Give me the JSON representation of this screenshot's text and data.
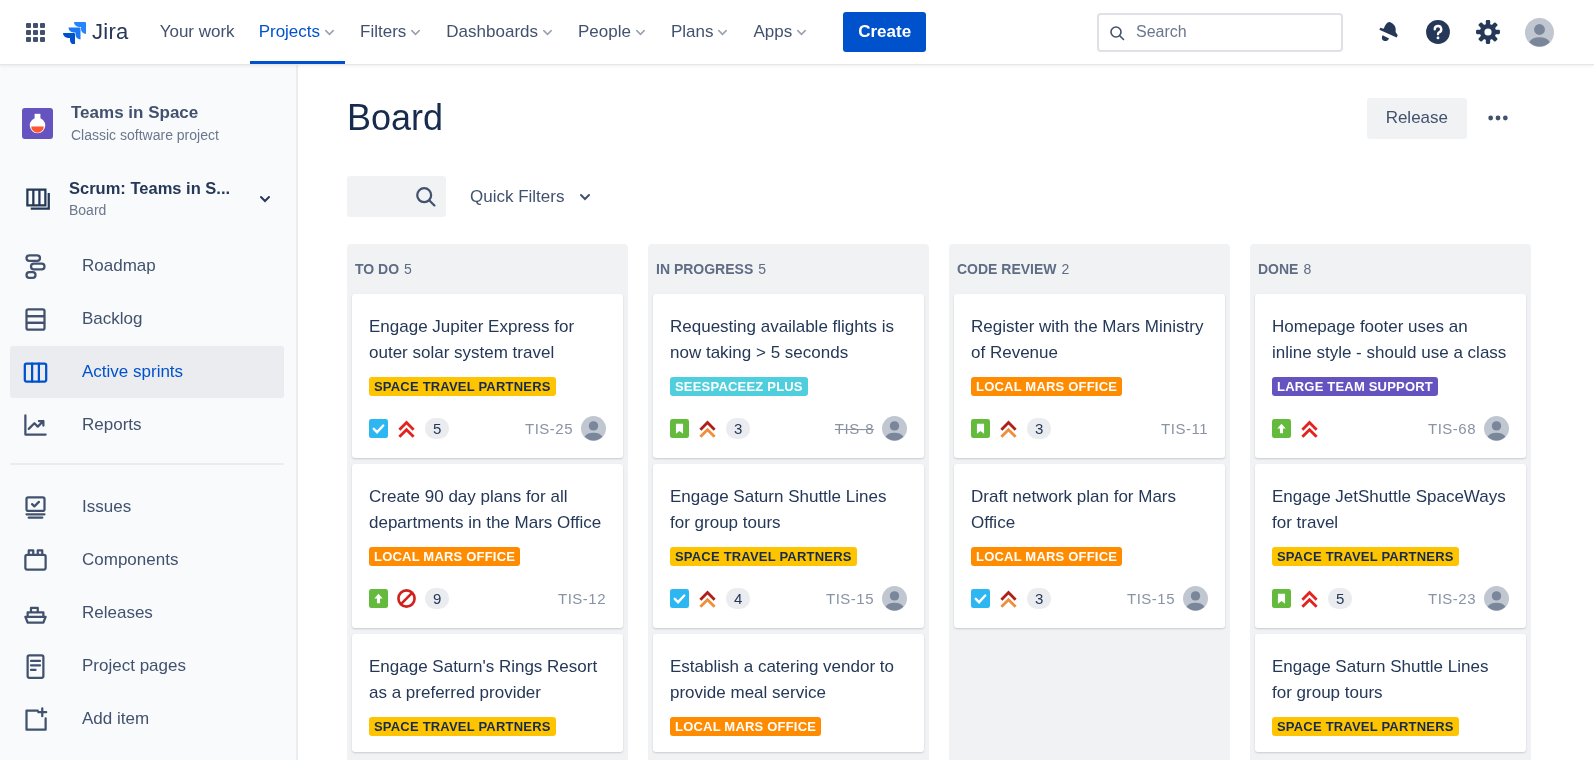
{
  "topbar": {
    "product": "Jira",
    "nav": [
      {
        "label": "Your work",
        "selected": false,
        "dropdown": false
      },
      {
        "label": "Projects",
        "selected": true,
        "dropdown": true
      },
      {
        "label": "Filters",
        "selected": false,
        "dropdown": true
      },
      {
        "label": "Dashboards",
        "selected": false,
        "dropdown": true
      },
      {
        "label": "People",
        "selected": false,
        "dropdown": true
      },
      {
        "label": "Plans",
        "selected": false,
        "dropdown": true
      },
      {
        "label": "Apps",
        "selected": false,
        "dropdown": true
      }
    ],
    "create_button": "Create",
    "search": {
      "placeholder": "Search"
    }
  },
  "sidebar": {
    "project": {
      "name": "Teams in Space",
      "type": "Classic software project"
    },
    "board": {
      "name": "Scrum: Teams in S...",
      "type": "Board"
    },
    "sections": [
      {
        "items": [
          {
            "label": "Roadmap",
            "selected": false
          },
          {
            "label": "Backlog",
            "selected": false
          },
          {
            "label": "Active sprints",
            "selected": true
          },
          {
            "label": "Reports",
            "selected": false
          }
        ]
      },
      {
        "items": [
          {
            "label": "Issues",
            "selected": false
          },
          {
            "label": "Components",
            "selected": false
          },
          {
            "label": "Releases",
            "selected": false
          },
          {
            "label": "Project pages",
            "selected": false
          },
          {
            "label": "Add item",
            "selected": false
          }
        ]
      }
    ]
  },
  "page": {
    "title": "Board",
    "release_button": "Release",
    "quick_filters": "Quick Filters"
  },
  "columns": [
    {
      "title": "TO DO",
      "count": "5",
      "cards": [
        {
          "summary": "Engage Jupiter Express for outer solar system travel",
          "label": "SPACE TRAVEL PARTNERS",
          "color": "#ffc400",
          "icons": [
            {
              "kind": "task"
            },
            {
              "kind": "highest"
            }
          ],
          "points": "5",
          "key": "TIS-25",
          "done": false,
          "assignee": true
        },
        {
          "summary": "Create 90 day plans for all departments in the Mars Office",
          "label": "LOCAL MARS OFFICE",
          "color": "#ff8b00",
          "icons": [
            {
              "kind": "improvement"
            },
            {
              "kind": "blocker"
            }
          ],
          "points": "9",
          "key": "TIS-12",
          "done": false,
          "assignee": false
        },
        {
          "summary": "Engage Saturn's Rings Resort as a preferred provider",
          "label": "SPACE TRAVEL PARTNERS",
          "color": "#ffc400"
        }
      ]
    },
    {
      "title": "IN PROGRESS",
      "count": "5",
      "cards": [
        {
          "summary": "Requesting available flights is now taking > 5 seconds",
          "label": "SEESPACEEZ PLUS",
          "color": "#4fcfdd",
          "icons": [
            {
              "kind": "story"
            },
            {
              "kind": "high"
            }
          ],
          "points": "3",
          "key": "TIS-8",
          "done": true,
          "assignee": true
        },
        {
          "summary": "Engage Saturn Shuttle Lines for group tours",
          "label": "SPACE TRAVEL PARTNERS",
          "color": "#ffc400",
          "icons": [
            {
              "kind": "task"
            },
            {
              "kind": "high"
            }
          ],
          "points": "4",
          "key": "TIS-15",
          "done": false,
          "assignee": true
        },
        {
          "summary": "Establish a catering vendor to provide meal service",
          "label": "LOCAL MARS OFFICE",
          "color": "#ff8b00"
        }
      ]
    },
    {
      "title": "CODE REVIEW",
      "count": "2",
      "cards": [
        {
          "summary": "Register with the Mars Ministry of Revenue",
          "label": "LOCAL MARS OFFICE",
          "color": "#ff8b00",
          "icons": [
            {
              "kind": "story"
            },
            {
              "kind": "high"
            }
          ],
          "points": "3",
          "key": "TIS-11",
          "done": false,
          "assignee": false
        },
        {
          "summary": "Draft network plan for Mars Office",
          "label": "LOCAL MARS OFFICE",
          "color": "#ff8b00",
          "icons": [
            {
              "kind": "task"
            },
            {
              "kind": "high"
            }
          ],
          "points": "3",
          "key": "TIS-15",
          "done": false,
          "assignee": true
        }
      ]
    },
    {
      "title": "DONE",
      "count": "8",
      "cards": [
        {
          "summary": "Homepage footer uses an inline style - should use a class",
          "label": "LARGE TEAM SUPPORT",
          "color": "#6554c0",
          "icons": [
            {
              "kind": "improvement"
            },
            {
              "kind": "highest"
            }
          ],
          "key": "TIS-68",
          "done": false,
          "assignee": true
        },
        {
          "summary": "Engage JetShuttle SpaceWays for travel",
          "label": "SPACE TRAVEL PARTNERS",
          "color": "#ffc400",
          "icons": [
            {
              "kind": "story"
            },
            {
              "kind": "highest"
            }
          ],
          "points": "5",
          "key": "TIS-23",
          "done": false,
          "assignee": true
        },
        {
          "summary": "Engage Saturn Shuttle Lines for group tours",
          "label": "SPACE TRAVEL PARTNERS",
          "color": "#ffc400"
        }
      ]
    }
  ]
}
